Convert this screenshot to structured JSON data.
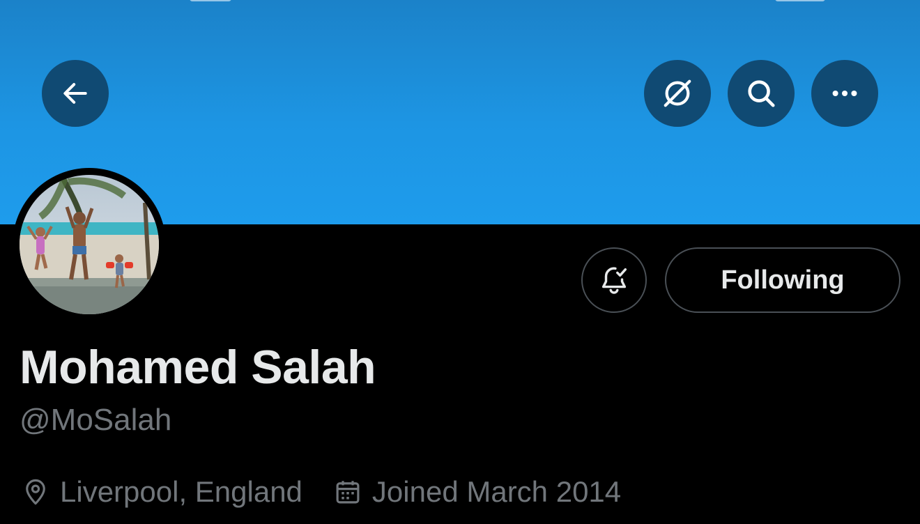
{
  "header": {
    "back_icon": "arrow-left-icon",
    "circle_icon": "circle-slash-icon",
    "search_icon": "search-icon",
    "more_icon": "more-horizontal-icon"
  },
  "profile": {
    "name": "Mohamed Salah",
    "handle": "@MoSalah",
    "location": "Liverpool, England",
    "joined": "Joined March 2014"
  },
  "actions": {
    "notify_icon": "bell-check-icon",
    "following_label": "Following"
  },
  "colors": {
    "banner": "#1d95e3",
    "header_button": "#104a73",
    "text_primary": "#e7e9ea",
    "text_secondary": "#71767b",
    "border": "#4a5056"
  }
}
